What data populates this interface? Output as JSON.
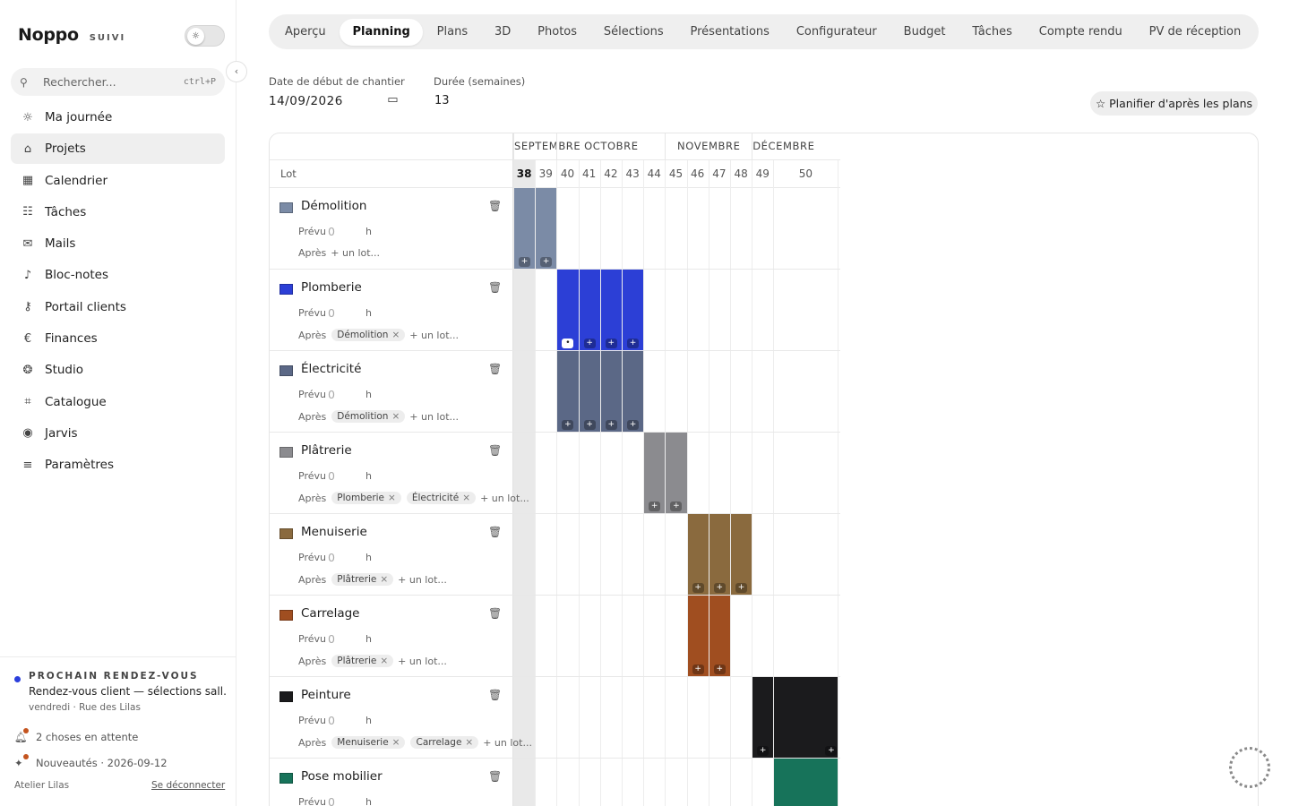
{
  "sidebar": {
    "brand": "Noppo",
    "brand_tag": "SUIVI",
    "search_placeholder": "Rechercher...",
    "search_shortcut": "ctrl+P",
    "items": [
      {
        "label": "Ma journée",
        "icon": "sun-icon",
        "active": false
      },
      {
        "label": "Projets",
        "icon": "home-icon",
        "active": true
      },
      {
        "label": "Calendrier",
        "icon": "calendar-icon",
        "active": false
      },
      {
        "label": "Tâches",
        "icon": "checklist-icon",
        "active": false
      },
      {
        "label": "Mails",
        "icon": "mail-icon",
        "active": false
      },
      {
        "label": "Bloc-notes",
        "icon": "microphone-icon",
        "active": false
      },
      {
        "label": "Portail clients",
        "icon": "key-icon",
        "active": false
      },
      {
        "label": "Finances",
        "icon": "euro-icon",
        "active": false
      },
      {
        "label": "Studio",
        "icon": "aperture-icon",
        "active": false
      },
      {
        "label": "Catalogue",
        "icon": "tag-icon",
        "active": false
      },
      {
        "label": "Jarvis",
        "icon": "broadcast-icon",
        "active": false
      },
      {
        "label": "Paramètres",
        "icon": "sliders-icon",
        "active": false
      }
    ],
    "next_meeting": {
      "heading": "PROCHAIN RENDEZ-VOUS",
      "title": "Rendez-vous client — sélections sall...",
      "meta": "vendredi · Rue des Lilas"
    },
    "pending": "2 choses en attente",
    "news": "Nouveautés · 2026-09-12",
    "org": "Atelier Lilas",
    "logout": "Se déconnecter"
  },
  "tabs": [
    {
      "label": "Aperçu",
      "active": false
    },
    {
      "label": "Planning",
      "active": true
    },
    {
      "label": "Plans",
      "active": false
    },
    {
      "label": "3D",
      "active": false
    },
    {
      "label": "Photos",
      "active": false
    },
    {
      "label": "Sélections",
      "active": false
    },
    {
      "label": "Présentations",
      "active": false
    },
    {
      "label": "Configurateur",
      "active": false
    },
    {
      "label": "Budget",
      "active": false
    },
    {
      "label": "Tâches",
      "active": false
    },
    {
      "label": "Compte rendu",
      "active": false
    },
    {
      "label": "PV de réception",
      "active": false
    }
  ],
  "form": {
    "start_label": "Date de début de chantier",
    "start_value": "14/09/2026",
    "duration_label": "Durée (semaines)",
    "duration_value": "13",
    "plan_button": "Planifier d'après les plans"
  },
  "gantt": {
    "lot_header": "Lot",
    "months": [
      {
        "label": "SEPTEMBRE",
        "weeks": 2
      },
      {
        "label": "OCTOBRE",
        "weeks": 5
      },
      {
        "label": "NOVEMBRE",
        "weeks": 4
      },
      {
        "label": "DÉCEMBRE",
        "weeks": 1
      }
    ],
    "weeks": [
      "38",
      "39",
      "40",
      "41",
      "42",
      "43",
      "44",
      "45",
      "46",
      "47",
      "48",
      "49",
      "50"
    ],
    "current_week": "38",
    "prevu_label": "Prévu",
    "prevu_value": "0",
    "prevu_unit": "h",
    "apres_label": "Après",
    "add_lot": "+ un lot...",
    "lots": [
      {
        "name": "Démolition",
        "color": "#7b8ba6",
        "after": [],
        "start_week": "38",
        "end_week": "39"
      },
      {
        "name": "Plomberie",
        "color": "#2c3fd6",
        "after": [
          "Démolition"
        ],
        "start_week": "40",
        "end_week": "43"
      },
      {
        "name": "Électricité",
        "color": "#5b6886",
        "after": [
          "Démolition"
        ],
        "start_week": "40",
        "end_week": "43"
      },
      {
        "name": "Plâtrerie",
        "color": "#8b8b8f",
        "after": [
          "Plomberie",
          "Électricité"
        ],
        "start_week": "44",
        "end_week": "45"
      },
      {
        "name": "Menuiserie",
        "color": "#8a6a3e",
        "after": [
          "Plâtrerie"
        ],
        "start_week": "46",
        "end_week": "48"
      },
      {
        "name": "Carrelage",
        "color": "#a04e20",
        "after": [
          "Plâtrerie"
        ],
        "start_week": "46",
        "end_week": "47"
      },
      {
        "name": "Peinture",
        "color": "#1b1b1d",
        "after": [
          "Menuiserie",
          "Carrelage"
        ],
        "start_week": "49",
        "end_week": "50"
      },
      {
        "name": "Pose mobilier",
        "color": "#17735a",
        "after": [],
        "start_week": "50",
        "end_week": "50"
      }
    ]
  }
}
